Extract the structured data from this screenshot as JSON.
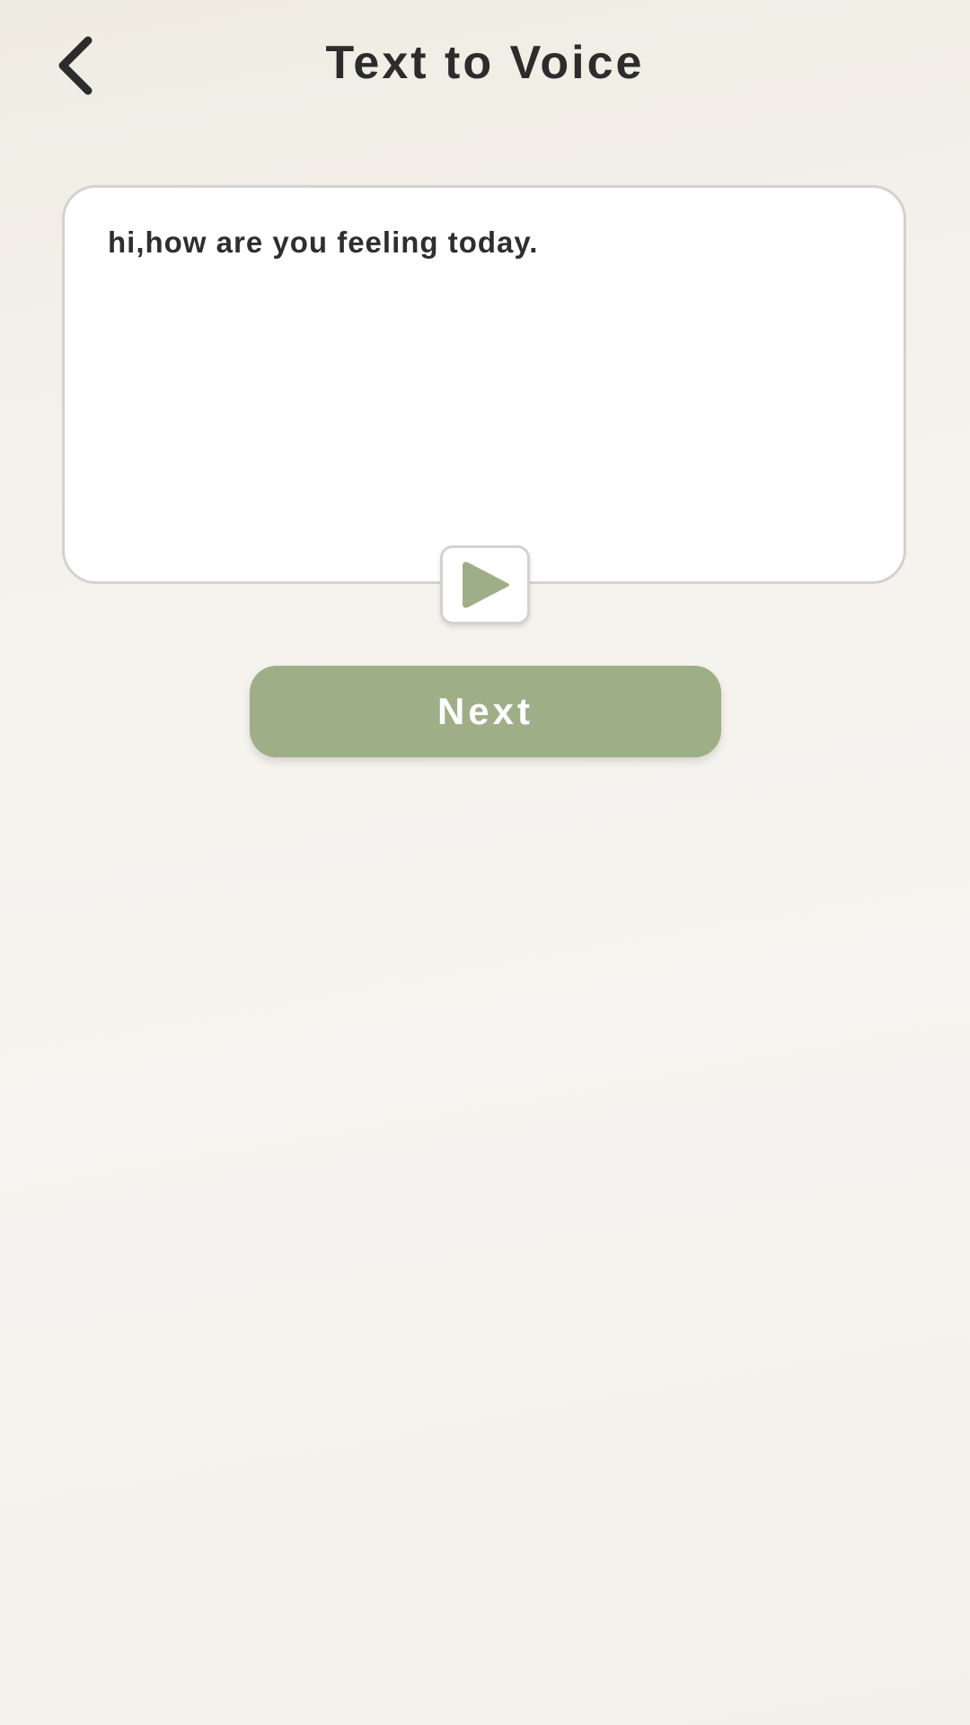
{
  "header": {
    "title": "Text to Voice",
    "back_icon": "chevron-left-icon"
  },
  "editor": {
    "text": "hi,how are you feeling today.",
    "play_icon": "play-icon"
  },
  "actions": {
    "next_label": "Next"
  },
  "colors": {
    "accent": "#9eae87",
    "text": "#2e2e2e",
    "card_border": "#d4d2cf"
  }
}
